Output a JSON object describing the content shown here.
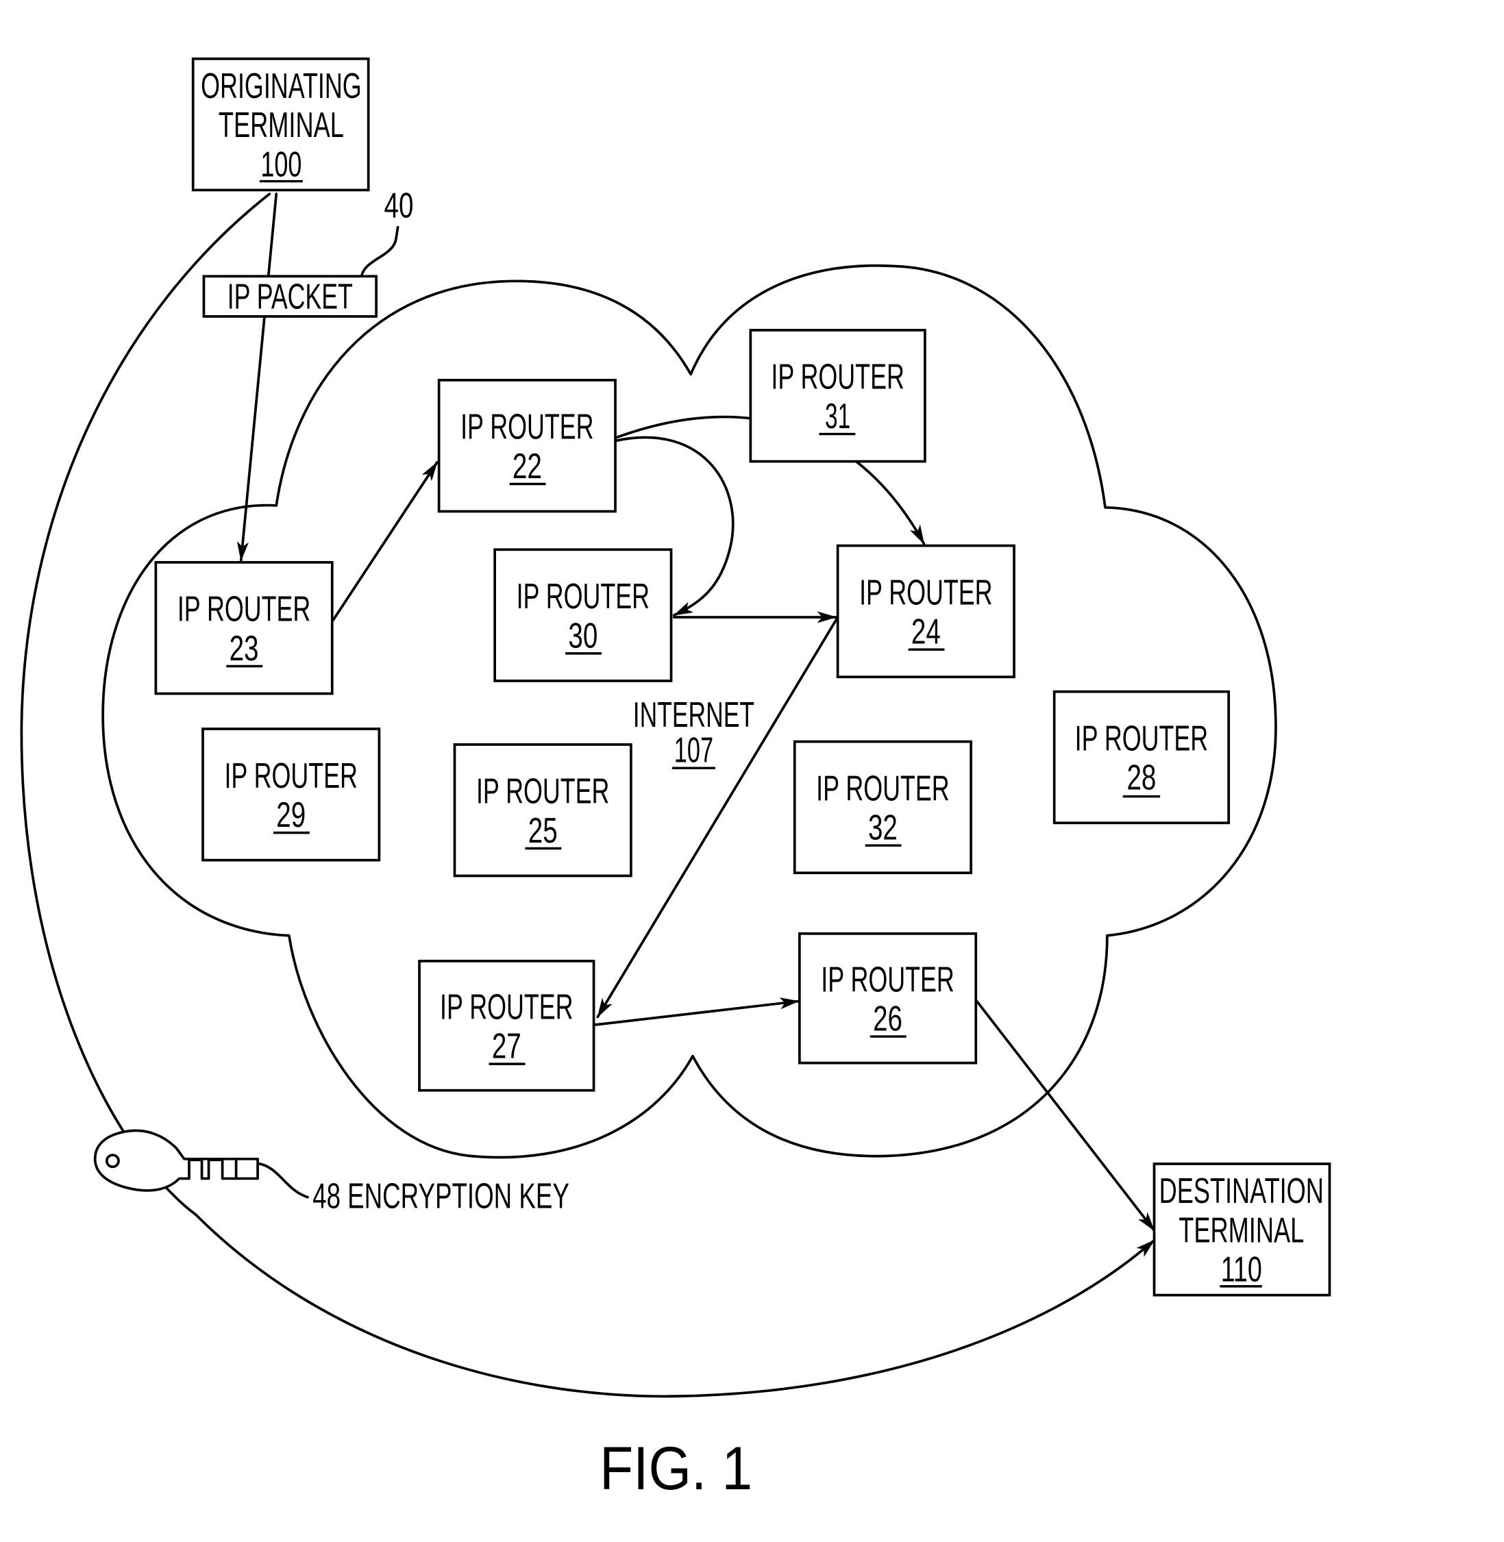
{
  "figure": {
    "caption": "FIG. 1",
    "network_label": "INTERNET",
    "network_ref": "107",
    "packet_label": "IP PACKET",
    "packet_ref": "40",
    "key_label": "48 ENCRYPTION KEY"
  },
  "terminals": {
    "origin": {
      "line1": "ORIGINATING",
      "line2": "TERMINAL",
      "ref": "100"
    },
    "destination": {
      "line1": "DESTINATION",
      "line2": "TERMINAL",
      "ref": "110"
    }
  },
  "routers": [
    {
      "id": "r22",
      "label": "IP ROUTER",
      "ref": "22"
    },
    {
      "id": "r23",
      "label": "IP ROUTER",
      "ref": "23"
    },
    {
      "id": "r24",
      "label": "IP ROUTER",
      "ref": "24"
    },
    {
      "id": "r25",
      "label": "IP ROUTER",
      "ref": "25"
    },
    {
      "id": "r26",
      "label": "IP ROUTER",
      "ref": "26"
    },
    {
      "id": "r27",
      "label": "IP ROUTER",
      "ref": "27"
    },
    {
      "id": "r28",
      "label": "IP ROUTER",
      "ref": "28"
    },
    {
      "id": "r29",
      "label": "IP ROUTER",
      "ref": "29"
    },
    {
      "id": "r30",
      "label": "IP ROUTER",
      "ref": "30"
    },
    {
      "id": "r31",
      "label": "IP ROUTER",
      "ref": "31"
    },
    {
      "id": "r32",
      "label": "IP ROUTER",
      "ref": "32"
    }
  ],
  "paths": [
    {
      "from": "100",
      "to": "23"
    },
    {
      "from": "23",
      "to": "22"
    },
    {
      "from": "22",
      "to": "30"
    },
    {
      "from": "22",
      "to": "24"
    },
    {
      "from": "30",
      "to": "24"
    },
    {
      "from": "24",
      "to": "27"
    },
    {
      "from": "27",
      "to": "26"
    },
    {
      "from": "26",
      "to": "110"
    },
    {
      "from": "100",
      "to": "110",
      "via": "48"
    }
  ]
}
